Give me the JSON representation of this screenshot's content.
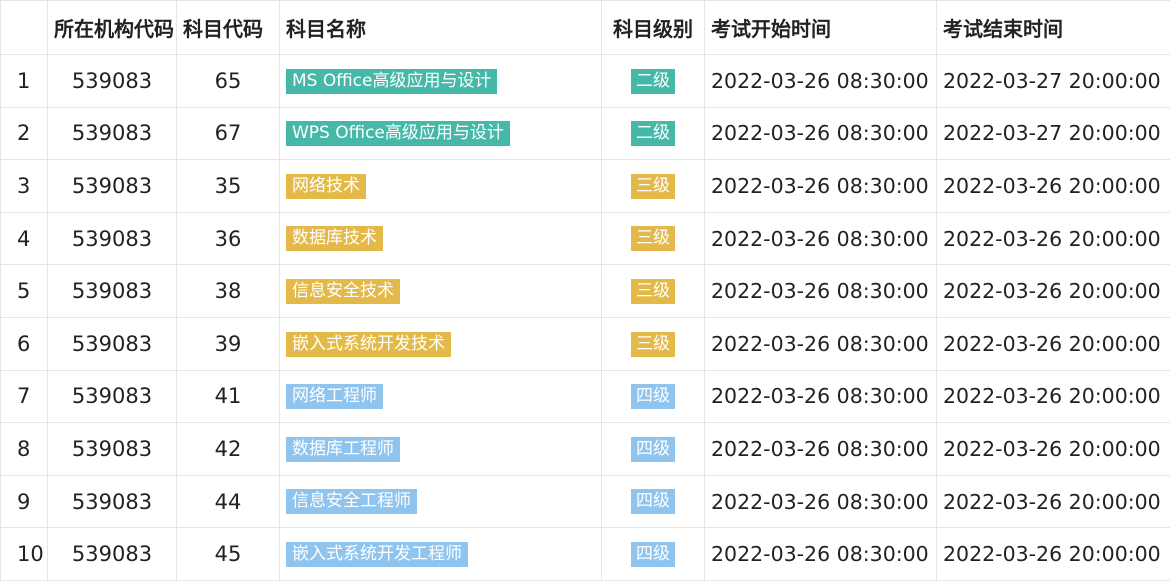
{
  "table": {
    "headers": {
      "org_code": "所在机构代码",
      "subject_code": "科目代码",
      "subject_name": "科目名称",
      "subject_level": "科目级别",
      "start_time": "考试开始时间",
      "end_time": "考试结束时间"
    },
    "colors": {
      "level_2": "#46b8a8",
      "level_3": "#e3b94a",
      "level_4": "#8ec4ee"
    },
    "rows": [
      {
        "index": "1",
        "org_code": "539083",
        "subject_code": "65",
        "subject_name": "MS Office高级应用与设计",
        "level": "二级",
        "level_key": "level_2",
        "start": "2022-03-26 08:30:00",
        "end": "2022-03-27 20:00:00"
      },
      {
        "index": "2",
        "org_code": "539083",
        "subject_code": "67",
        "subject_name": "WPS Office高级应用与设计",
        "level": "二级",
        "level_key": "level_2",
        "start": "2022-03-26 08:30:00",
        "end": "2022-03-27 20:00:00"
      },
      {
        "index": "3",
        "org_code": "539083",
        "subject_code": "35",
        "subject_name": "网络技术",
        "level": "三级",
        "level_key": "level_3",
        "start": "2022-03-26 08:30:00",
        "end": "2022-03-26 20:00:00"
      },
      {
        "index": "4",
        "org_code": "539083",
        "subject_code": "36",
        "subject_name": "数据库技术",
        "level": "三级",
        "level_key": "level_3",
        "start": "2022-03-26 08:30:00",
        "end": "2022-03-26 20:00:00"
      },
      {
        "index": "5",
        "org_code": "539083",
        "subject_code": "38",
        "subject_name": "信息安全技术",
        "level": "三级",
        "level_key": "level_3",
        "start": "2022-03-26 08:30:00",
        "end": "2022-03-26 20:00:00"
      },
      {
        "index": "6",
        "org_code": "539083",
        "subject_code": "39",
        "subject_name": "嵌入式系统开发技术",
        "level": "三级",
        "level_key": "level_3",
        "start": "2022-03-26 08:30:00",
        "end": "2022-03-26 20:00:00"
      },
      {
        "index": "7",
        "org_code": "539083",
        "subject_code": "41",
        "subject_name": "网络工程师",
        "level": "四级",
        "level_key": "level_4",
        "start": "2022-03-26 08:30:00",
        "end": "2022-03-26 20:00:00"
      },
      {
        "index": "8",
        "org_code": "539083",
        "subject_code": "42",
        "subject_name": "数据库工程师",
        "level": "四级",
        "level_key": "level_4",
        "start": "2022-03-26 08:30:00",
        "end": "2022-03-26 20:00:00"
      },
      {
        "index": "9",
        "org_code": "539083",
        "subject_code": "44",
        "subject_name": "信息安全工程师",
        "level": "四级",
        "level_key": "level_4",
        "start": "2022-03-26 08:30:00",
        "end": "2022-03-26 20:00:00"
      },
      {
        "index": "10",
        "org_code": "539083",
        "subject_code": "45",
        "subject_name": "嵌入式系统开发工程师",
        "level": "四级",
        "level_key": "level_4",
        "start": "2022-03-26 08:30:00",
        "end": "2022-03-26 20:00:00"
      }
    ]
  }
}
